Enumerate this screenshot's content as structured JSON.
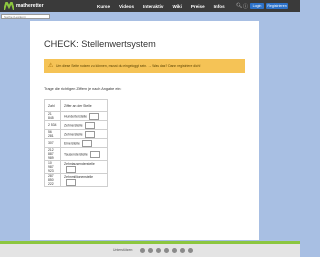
{
  "header": {
    "logo_text": "matheretter",
    "nav": [
      "Kurse",
      "Videos",
      "Interaktiv",
      "Wiki",
      "Preise",
      "Infos"
    ],
    "login_label": "Login",
    "register_label": "Registrieren"
  },
  "search": {
    "placeholder": "Suche (Lexikon)"
  },
  "main": {
    "title": "CHECK: Stellenwertsystem",
    "alert": "Um diese Seite nutzen zu können, musst du eingeloggt sein. → Was das? Dann registriere dich!",
    "instruction": "Trage die richtigen Ziffern je nach Angabe ein:",
    "table": {
      "headers": [
        "Zahl",
        "Ziffer an der Stelle"
      ],
      "rows": [
        {
          "number": "21 845",
          "place": "Hunderterstelle"
        },
        {
          "number": "2 534",
          "place": "Zehnerstelle"
        },
        {
          "number": "56 281",
          "place": "Zehnerstelle"
        },
        {
          "number": "307",
          "place": "Einerstelle"
        },
        {
          "number": "212 887 989",
          "place": "Tausenderstelle"
        },
        {
          "number": "10 987 923",
          "place": "Zehntausenderstelle"
        },
        {
          "number": "287 850 222",
          "place": "Zehnmillionenstelle"
        }
      ]
    }
  },
  "footer": {
    "label": "Unterstützen:"
  },
  "colors": {
    "accent_green": "#8cc63f",
    "login_blue": "#2d72c9",
    "alert_yellow": "#f5c356"
  },
  "icons": [
    "logo-m-icon",
    "search-icon",
    "info-icon",
    "warning-icon"
  ]
}
